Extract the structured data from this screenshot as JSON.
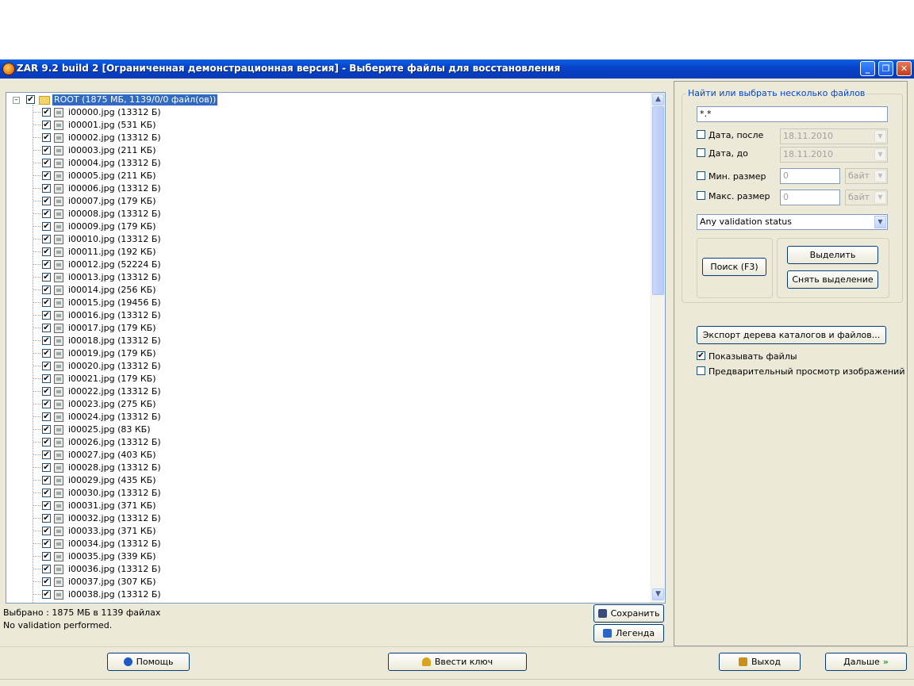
{
  "window": {
    "title": "ZAR 9.2 build 2 [Ограниченная демонстрационная версия] - Выберите файлы для восстановления",
    "minimize_glyph": "_",
    "maximize_glyph": "❐",
    "close_glyph": "✕"
  },
  "tree": {
    "root_label": "ROOT (1875 МБ, 1139/0/0 файл(ов))",
    "root_checked": true,
    "files": [
      "i00000.jpg (13312 Б)",
      "i00001.jpg (531 КБ)",
      "i00002.jpg (13312 Б)",
      "i00003.jpg (211 КБ)",
      "i00004.jpg (13312 Б)",
      "i00005.jpg (211 КБ)",
      "i00006.jpg (13312 Б)",
      "i00007.jpg (179 КБ)",
      "i00008.jpg (13312 Б)",
      "i00009.jpg (179 КБ)",
      "i00010.jpg (13312 Б)",
      "i00011.jpg (192 КБ)",
      "i00012.jpg (52224 Б)",
      "i00013.jpg (13312 Б)",
      "i00014.jpg (256 КБ)",
      "i00015.jpg (19456 Б)",
      "i00016.jpg (13312 Б)",
      "i00017.jpg (179 КБ)",
      "i00018.jpg (13312 Б)",
      "i00019.jpg (179 КБ)",
      "i00020.jpg (13312 Б)",
      "i00021.jpg (179 КБ)",
      "i00022.jpg (13312 Б)",
      "i00023.jpg (275 КБ)",
      "i00024.jpg (13312 Б)",
      "i00025.jpg (83 КБ)",
      "i00026.jpg (13312 Б)",
      "i00027.jpg (403 КБ)",
      "i00028.jpg (13312 Б)",
      "i00029.jpg (435 КБ)",
      "i00030.jpg (13312 Б)",
      "i00031.jpg (371 КБ)",
      "i00032.jpg (13312 Б)",
      "i00033.jpg (371 КБ)",
      "i00034.jpg (13312 Б)",
      "i00035.jpg (339 КБ)",
      "i00036.jpg (13312 Б)",
      "i00037.jpg (307 КБ)",
      "i00038.jpg (13312 Б)"
    ]
  },
  "status": {
    "selected": "Выбрано : 1875 МБ в 1139 файлах",
    "validation": "No validation performed."
  },
  "left_buttons": {
    "save": "Сохранить",
    "legend": "Легенда"
  },
  "search": {
    "group_title": "Найти или выбрать несколько файлов",
    "mask_value": "*.*",
    "date_after_label": "Дата, после",
    "date_after_value": "18.11.2010",
    "date_before_label": "Дата, до",
    "date_before_value": "18.11.2010",
    "min_size_label": "Мин. размер",
    "min_size_value": "0",
    "min_size_unit": "байт",
    "max_size_label": "Макс. размер",
    "max_size_value": "0",
    "max_size_unit": "байт",
    "validation_select": "Any validation status",
    "search_button": "Поиск (F3)",
    "select_button": "Выделить",
    "deselect_button": "Снять выделение"
  },
  "options": {
    "export_button": "Экспорт дерева каталогов и файлов...",
    "show_files_label": "Показывать файлы",
    "show_files_checked": true,
    "preview_label": "Предварительный просмотр изображений",
    "preview_checked": false
  },
  "footer": {
    "help": "Помощь",
    "enter_key": "Ввести ключ",
    "exit": "Выход",
    "next": "Дальше"
  },
  "colors": {
    "title_bar": "#0841c8",
    "selection": "#316ac5",
    "group_title": "#0046d5",
    "next_arrow": "#2f9e1f"
  }
}
